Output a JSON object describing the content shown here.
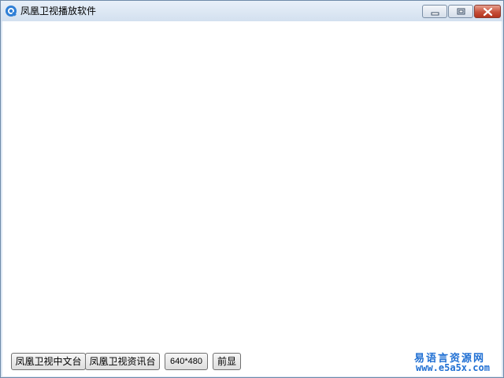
{
  "window": {
    "title": "凤凰卫视播放软件",
    "icon": "media-player-icon"
  },
  "titlebar_buttons": {
    "minimize": "minimize-icon",
    "maximize": "maximize-icon",
    "close": "close-icon"
  },
  "toolbar": {
    "chinese_channel_label": "凤凰卫视中文台",
    "info_channel_label": "凤凰卫视资讯台",
    "resolution_label": "640*480",
    "on_top_label": "前显"
  },
  "watermark": {
    "name": "易语言资源网",
    "url": "www.e5a5x.com"
  },
  "colors": {
    "accent": "#1f6fd3",
    "close_button": "#c7503a",
    "titlebar": "#dbe6f3"
  }
}
